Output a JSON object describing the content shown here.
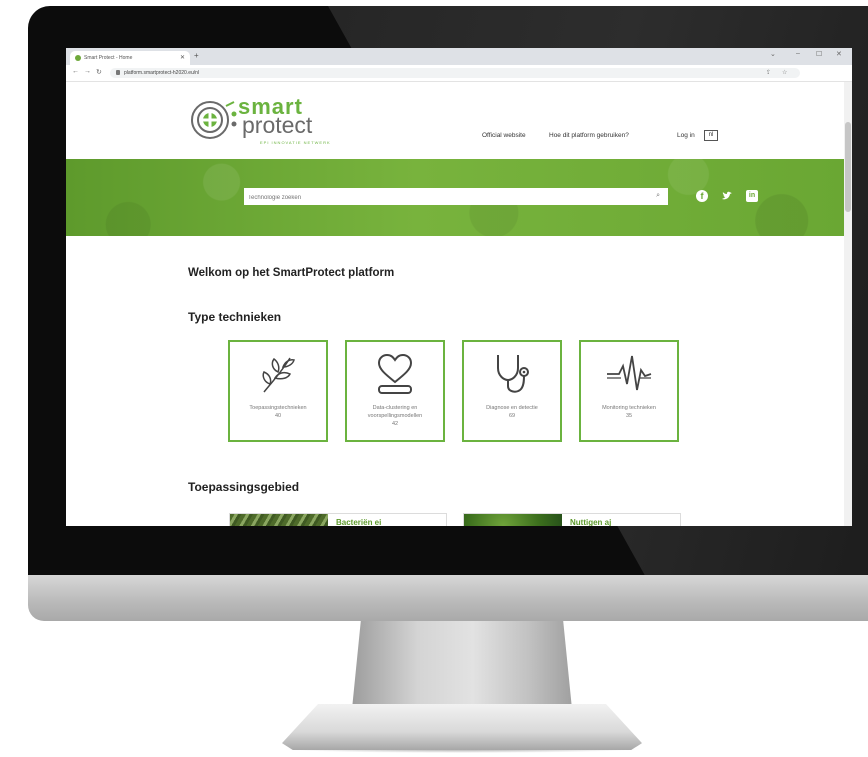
{
  "browser": {
    "tab_title": "Smart Protect - Home",
    "url": "platform.smartprotect-h2020.eu/nl"
  },
  "site": {
    "logo_smart": "smart",
    "logo_protect": "protect",
    "logo_tagline": "EPI INNOVATIE NETWERK",
    "nav": {
      "official_website": "Official website",
      "how_to_use": "Hoe dit platform gebruiken?",
      "login": "Log in",
      "language": "nl"
    },
    "search": {
      "placeholder": "Technologie zoeken"
    },
    "social": [
      "facebook-icon",
      "twitter-icon",
      "linkedin-icon"
    ],
    "welcome": "Welkom op het SmartProtect platform",
    "types_title": "Type technieken",
    "types": [
      {
        "label": "Toepassingstechnieken",
        "count": "40",
        "icon": "plant-icon"
      },
      {
        "label": "Data-clustering en voorspellingsmodellen",
        "count": "42",
        "icon": "heart-icon"
      },
      {
        "label": "Diagnose en detectie",
        "count": "69",
        "icon": "stethoscope-icon"
      },
      {
        "label": "Monitoring technieken",
        "count": "35",
        "icon": "pulse-icon"
      }
    ],
    "application_title": "Toepassingsgebied",
    "applications": [
      {
        "label": "Bacteriën ei"
      },
      {
        "label": "Nuttigen aj"
      }
    ]
  },
  "colors": {
    "brand_green": "#6bb33f",
    "hero_green": "#6aa733"
  }
}
